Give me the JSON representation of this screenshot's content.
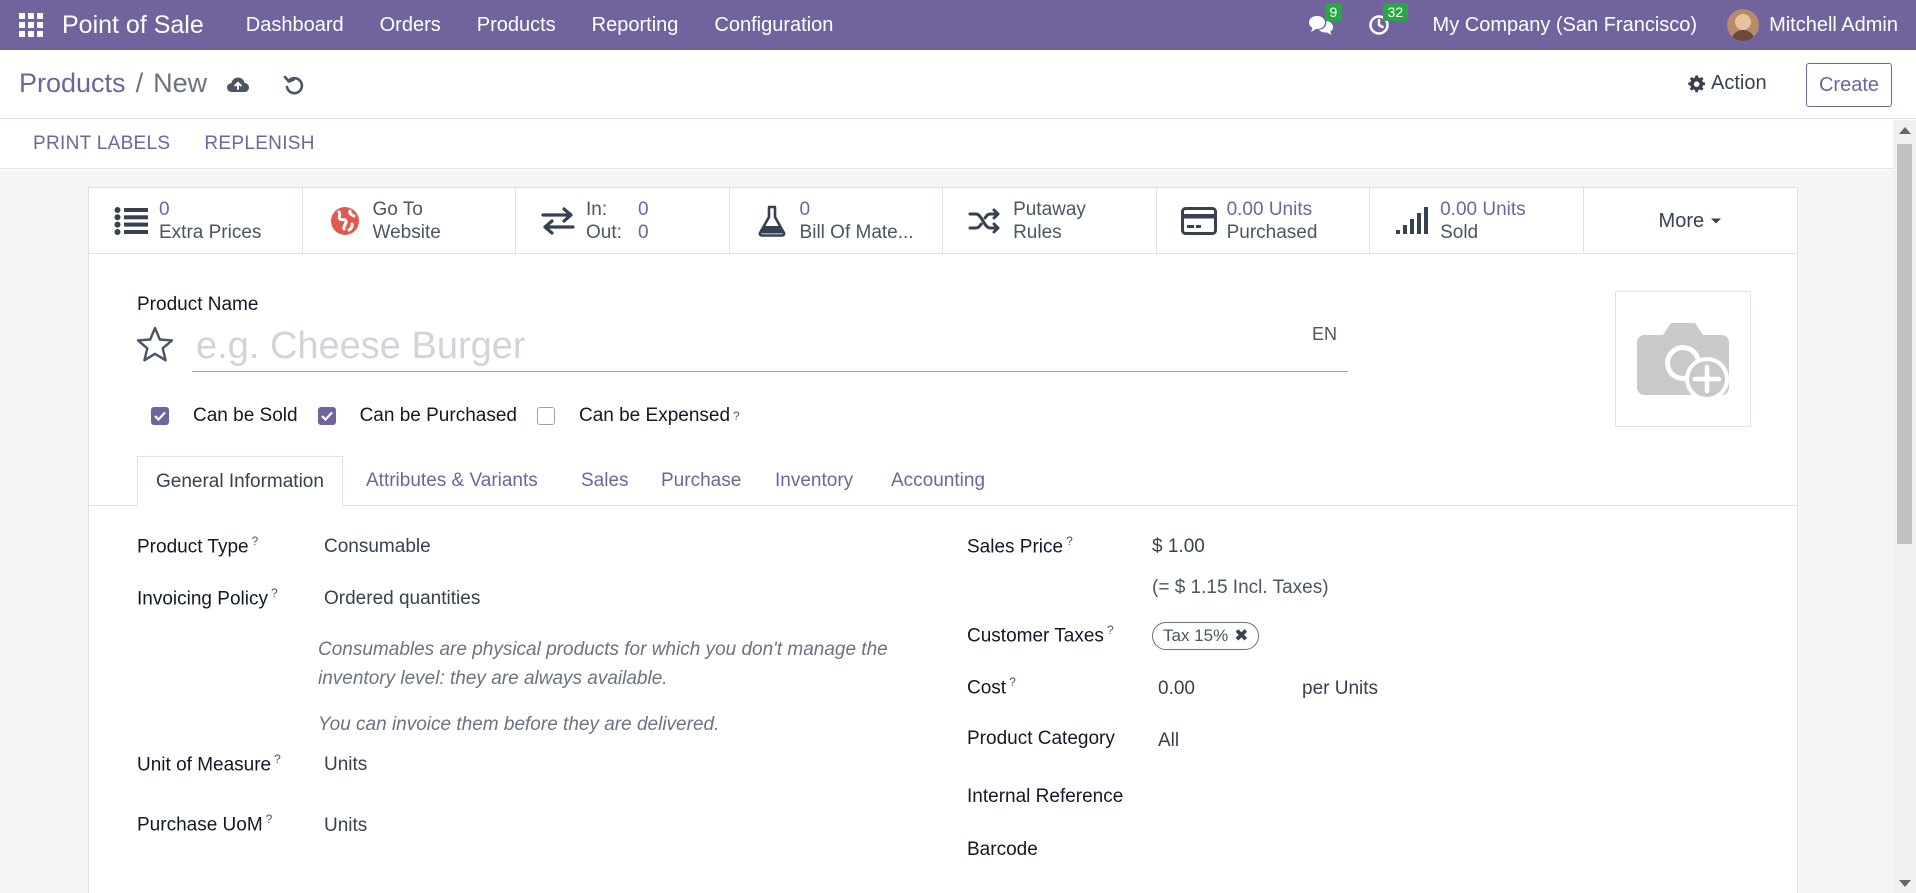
{
  "navbar": {
    "brand": "Point of Sale",
    "menu": [
      "Dashboard",
      "Orders",
      "Products",
      "Reporting",
      "Configuration"
    ],
    "messages_count": "9",
    "activities_count": "32",
    "company": "My Company (San Francisco)",
    "user": "Mitchell Admin"
  },
  "control": {
    "breadcrumb_parent": "Products",
    "breadcrumb_sep": "/",
    "breadcrumb_current": "New",
    "action_label": "Action",
    "create_label": "Create"
  },
  "buttons": {
    "print_labels": "PRINT LABELS",
    "replenish": "REPLENISH"
  },
  "smart_buttons": {
    "extra_prices_value": "0",
    "extra_prices_label": "Extra Prices",
    "website_line1": "Go To",
    "website_line2": "Website",
    "in_label": "In:",
    "in_value": "0",
    "out_label": "Out:",
    "out_value": "0",
    "bom_value": "0",
    "bom_label": "Bill Of Mate...",
    "putaway_line1": "Putaway",
    "putaway_line2": "Rules",
    "purchased_value": "0.00 Units",
    "purchased_label": "Purchased",
    "sold_value": "0.00 Units",
    "sold_label": "Sold",
    "more_label": "More"
  },
  "title": {
    "label": "Product Name",
    "placeholder": "e.g. Cheese Burger",
    "lang": "EN"
  },
  "checkboxes": {
    "can_be_sold": "Can be Sold",
    "can_be_purchased": "Can be Purchased",
    "can_be_expensed": "Can be Expensed"
  },
  "tabs": [
    "General Information",
    "Attributes & Variants",
    "Sales",
    "Purchase",
    "Inventory",
    "Accounting"
  ],
  "fields": {
    "product_type_label": "Product Type",
    "product_type_value": "Consumable",
    "invoicing_policy_label": "Invoicing Policy",
    "invoicing_policy_value": "Ordered quantities",
    "help_consumable": "Consumables are physical products for which you don't manage the inventory level: they are always available.",
    "help_invoice": "You can invoice them before they are delivered.",
    "uom_label": "Unit of Measure",
    "uom_value": "Units",
    "purchase_uom_label": "Purchase UoM",
    "purchase_uom_value": "Units",
    "sales_price_label": "Sales Price",
    "sales_price_value": "$ 1.00",
    "sales_price_incl": "(= $ 1.15 Incl. Taxes)",
    "customer_taxes_label": "Customer Taxes",
    "tax_tag": "Tax 15%",
    "cost_label": "Cost",
    "cost_value": "0.00",
    "cost_unit": "per Units",
    "category_label": "Product Category",
    "category_value": "All",
    "internal_ref_label": "Internal Reference",
    "barcode_label": "Barcode",
    "help_mark": "?"
  },
  "colors": {
    "brand": "#71639e",
    "badge": "#28a745"
  }
}
